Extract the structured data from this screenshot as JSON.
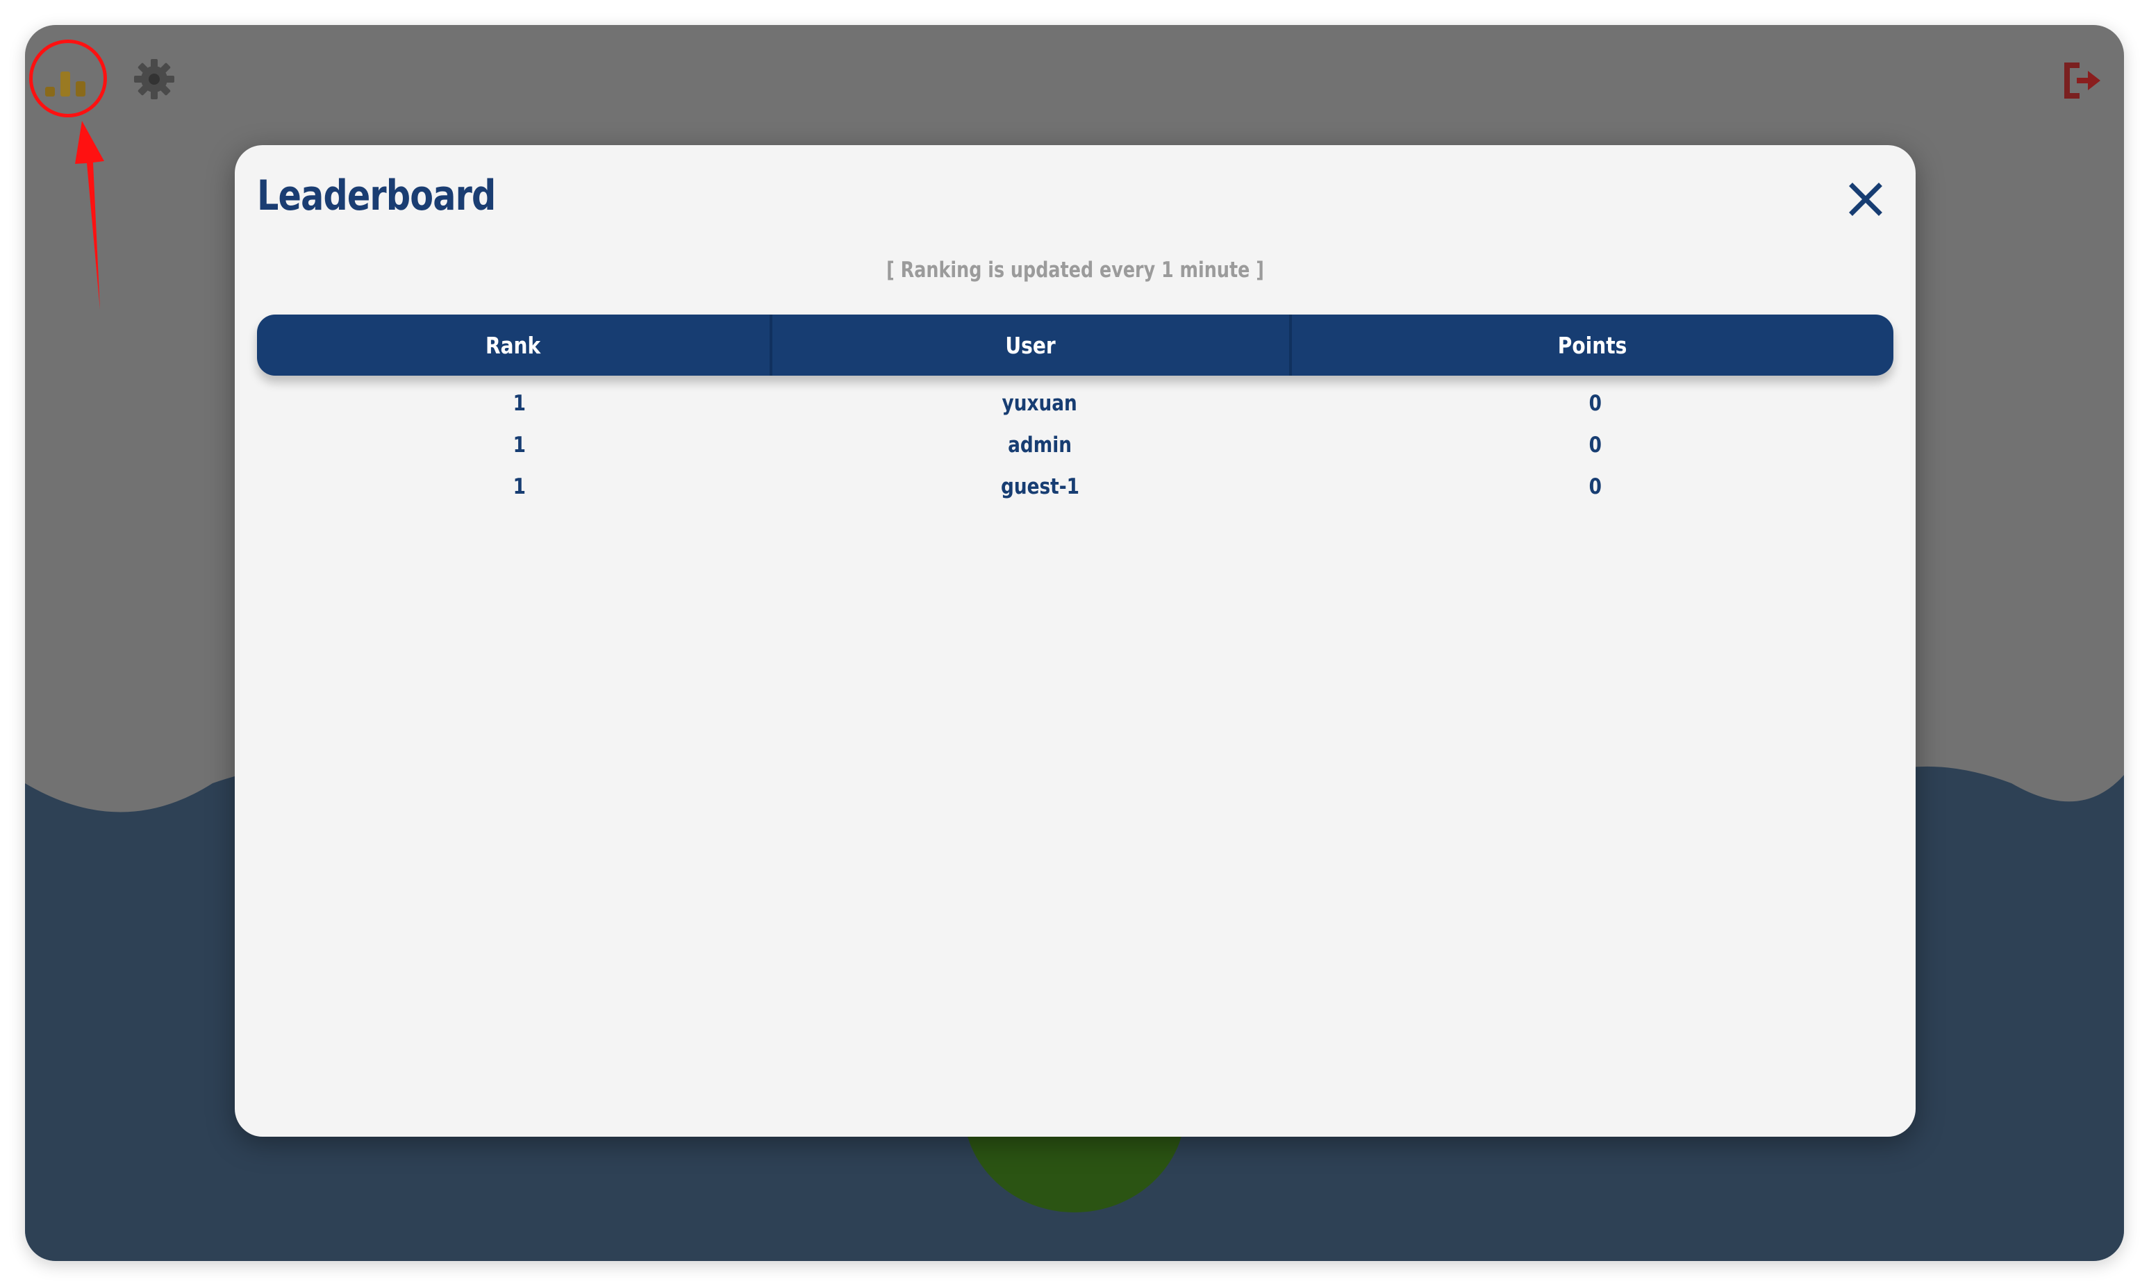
{
  "toolbar": {
    "leaderboard_icon": "leaderboard-icon",
    "settings_icon": "gear-icon",
    "logout_icon": "logout-icon"
  },
  "modal": {
    "title": "Leaderboard",
    "close_icon": "close-icon",
    "subtitle": "[ Ranking is updated every 1 minute ]",
    "columns": [
      "Rank",
      "User",
      "Points"
    ],
    "rows": [
      {
        "rank": "1",
        "user": "yuxuan",
        "points": "0"
      },
      {
        "rank": "1",
        "user": "admin",
        "points": "0"
      },
      {
        "rank": "1",
        "user": "guest-1",
        "points": "0"
      }
    ]
  },
  "colors": {
    "primary": "#173d72",
    "modal_bg": "#f4f4f4",
    "water": "#2e4a68",
    "annotation": "#ff1111"
  }
}
